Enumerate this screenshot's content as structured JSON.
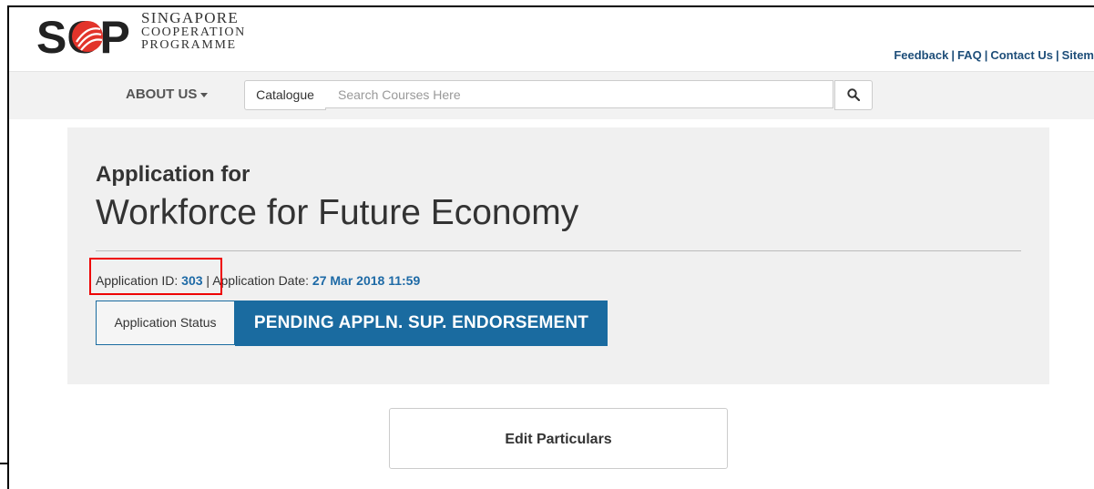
{
  "header": {
    "logo": {
      "mark": "SCP",
      "line1": "SINGAPORE",
      "line2": "COOPERATION",
      "line3": "PROGRAMME",
      "accent_color": "#e2342b"
    },
    "links": [
      "Feedback",
      "FAQ",
      "Contact Us",
      "Sitem"
    ]
  },
  "nav": {
    "about_label": "ABOUT US",
    "catalogue_label": "Catalogue",
    "search_placeholder": "Search Courses Here"
  },
  "application": {
    "heading": "Application for",
    "course_title": "Workforce for Future Economy",
    "id_label": "Application ID:",
    "id_value": "303",
    "date_label": "Application Date:",
    "date_value": "27 Mar 2018 11:59",
    "status_label": "Application Status",
    "status_value": "PENDING APPLN. SUP. ENDORSEMENT",
    "status_color": "#1a6ba0"
  },
  "actions": {
    "edit_label": "Edit Particulars"
  }
}
